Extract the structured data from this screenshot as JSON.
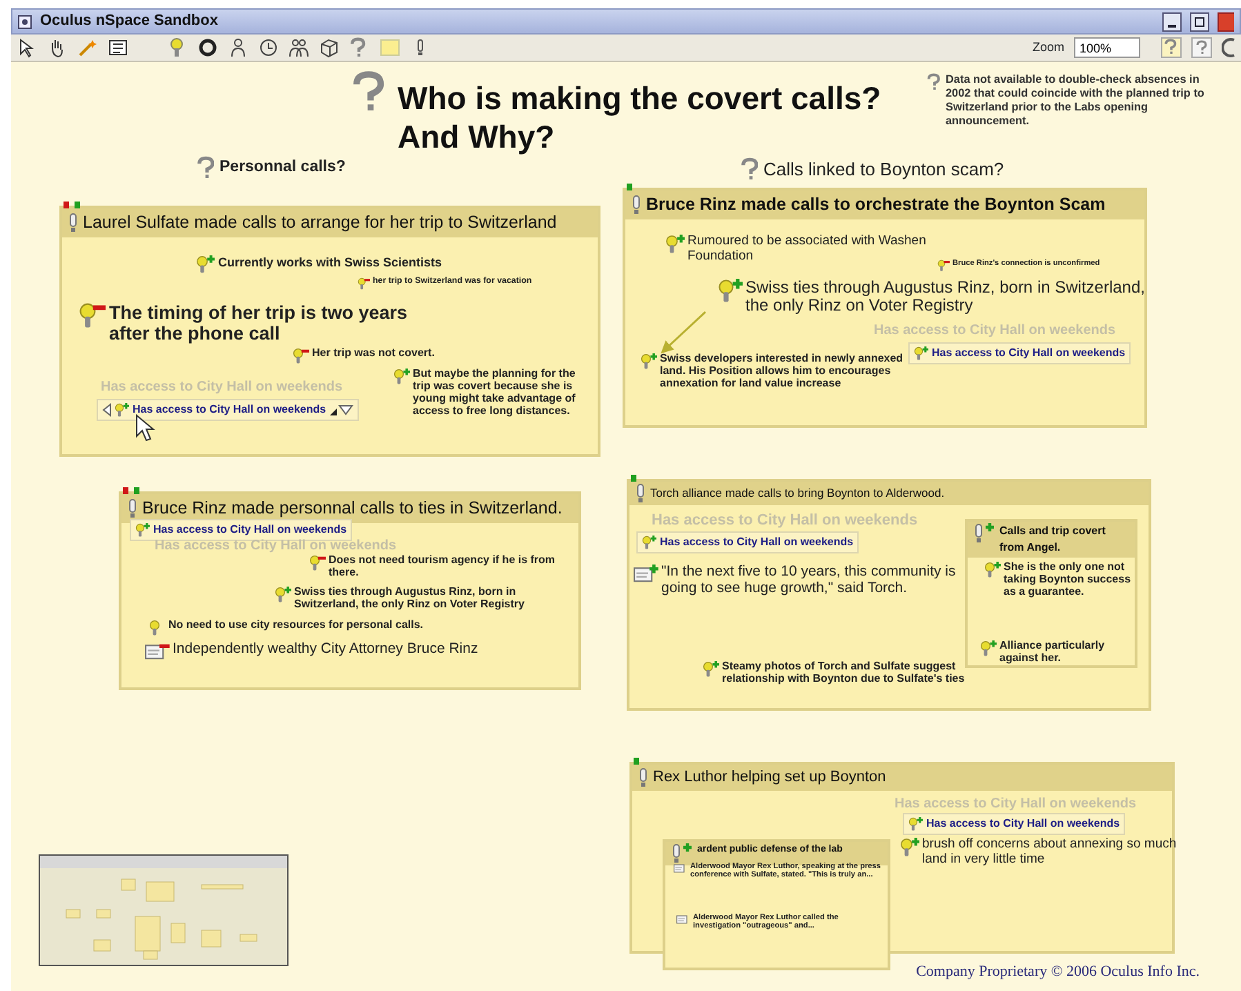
{
  "window": {
    "title": "Oculus nSpace Sandbox"
  },
  "toolbar": {
    "zoom_label": "Zoom",
    "zoom_value": "100%"
  },
  "canvas": {
    "title_lines": [
      "Who is making the covert calls?",
      "And Why?"
    ],
    "note": "Data not available to double-check absences in 2002 that could coincide with the planned trip to Switzerland prior to the Labs opening announcement.",
    "headings": [
      "Personnal calls?",
      "Calls linked to Boynton scam?"
    ],
    "groups": [
      {
        "title": "Laurel Sulfate made calls to arrange for her trip to Switzerland",
        "contradicted": true,
        "supported": true,
        "items": [
          {
            "kind": "evidence",
            "supports": true,
            "contradicts": false,
            "text": "Currently works with Swiss Scientists"
          },
          {
            "kind": "evidence",
            "supports": false,
            "contradicts": true,
            "text": "her trip to Switzerland was for vacation"
          },
          {
            "kind": "evidence",
            "supports": false,
            "contradicts": true,
            "text": "The timing of her trip is two years after the phone call"
          },
          {
            "kind": "evidence",
            "supports": false,
            "contradicts": true,
            "text": "Her trip was not covert."
          },
          {
            "kind": "ghost",
            "text": "Has access to City Hall on weekends"
          },
          {
            "kind": "link",
            "supports": true,
            "contradicts": false,
            "text": "Has access to City Hall on weekends"
          },
          {
            "kind": "evidence",
            "supports": true,
            "contradicts": false,
            "text": "But maybe the planning for the trip was covert because she is young might take advantage of access to free long distances."
          }
        ]
      },
      {
        "title": "Bruce Rinz made calls to orchestrate the Boynton Scam",
        "contradicted": false,
        "supported": true,
        "items": [
          {
            "kind": "evidence",
            "supports": true,
            "contradicts": false,
            "text": "Rumoured to be associated with Washen Foundation"
          },
          {
            "kind": "evidence",
            "supports": false,
            "contradicts": true,
            "text": "Bruce Rinz's connection is unconfirmed"
          },
          {
            "kind": "evidence",
            "supports": true,
            "contradicts": false,
            "text": "Swiss ties through Augustus Rinz, born in Switzerland,  the only Rinz on Voter Registry"
          },
          {
            "kind": "ghost",
            "text": "Has access to City Hall on weekends"
          },
          {
            "kind": "link",
            "supports": true,
            "contradicts": false,
            "text": "Has access to City Hall on weekends"
          },
          {
            "kind": "evidence",
            "supports": true,
            "contradicts": false,
            "text": "Swiss developers interested in newly annexed land. His Position allows him to encourages annexation for land value increase"
          }
        ]
      },
      {
        "title": "Bruce Rinz made personnal calls to ties in Switzerland.",
        "contradicted": true,
        "supported": true,
        "items": [
          {
            "kind": "link",
            "supports": true,
            "contradicts": false,
            "text": "Has access to City Hall on weekends"
          },
          {
            "kind": "ghost",
            "text": "Has access to City Hall on weekends"
          },
          {
            "kind": "evidence",
            "supports": false,
            "contradicts": true,
            "text": "Does not need tourism agency if he is from there."
          },
          {
            "kind": "evidence",
            "supports": true,
            "contradicts": false,
            "text": "Swiss ties through Augustus Rinz, born in Switzerland,  the only Rinz on Voter Registry"
          },
          {
            "kind": "evidence",
            "supports": false,
            "contradicts": false,
            "text": "No need to use city resources for personal calls."
          },
          {
            "kind": "document",
            "supports": false,
            "contradicts": true,
            "text": "Independently wealthy City Attorney Bruce Rinz"
          }
        ]
      },
      {
        "title": "Torch alliance made calls to bring Boynton to Alderwood.",
        "contradicted": false,
        "supported": true,
        "items": [
          {
            "kind": "ghost",
            "text": "Has access to City Hall on weekends"
          },
          {
            "kind": "link",
            "supports": true,
            "contradicts": false,
            "text": "Has access to City Hall on weekends"
          },
          {
            "kind": "document",
            "supports": true,
            "contradicts": false,
            "text": "\"In the next five to 10 years, this community is going to see huge growth,\" said Torch."
          },
          {
            "kind": "evidence",
            "supports": true,
            "contradicts": false,
            "text": "Steamy photos of Torch and Sulfate suggest relationship with Boynton due to Sulfate's ties"
          }
        ],
        "subgroups": [
          {
            "title": "Calls and trip covert from Angel.",
            "supported": true,
            "items": [
              {
                "kind": "evidence",
                "supports": true,
                "contradicts": false,
                "text": "She is the only one not taking Boynton success as a guarantee."
              },
              {
                "kind": "evidence",
                "supports": true,
                "contradicts": false,
                "text": "Alliance particularly against her."
              }
            ]
          }
        ]
      },
      {
        "title": "Rex Luthor helping set up Boynton",
        "contradicted": false,
        "supported": true,
        "items": [
          {
            "kind": "ghost",
            "text": "Has access to City Hall on weekends"
          },
          {
            "kind": "link",
            "supports": true,
            "contradicts": false,
            "text": "Has access to City Hall on weekends"
          },
          {
            "kind": "evidence",
            "supports": true,
            "contradicts": false,
            "text": "brush off concerns about annexing so much land in very little time"
          }
        ],
        "subgroups": [
          {
            "title": "ardent public defense of the lab",
            "supported": true,
            "items": [
              {
                "kind": "document",
                "supports": false,
                "contradicts": false,
                "text": "Alderwood Mayor Rex Luthor, speaking at the press conference with Sulfate, stated. \"This is truly an..."
              },
              {
                "kind": "document",
                "supports": false,
                "contradicts": false,
                "text": "Alderwood Mayor Rex Luthor called the investigation \"outrageous\" and..."
              }
            ]
          }
        ]
      }
    ],
    "footer": "Company Proprietary © 2006 Oculus Info Inc."
  }
}
